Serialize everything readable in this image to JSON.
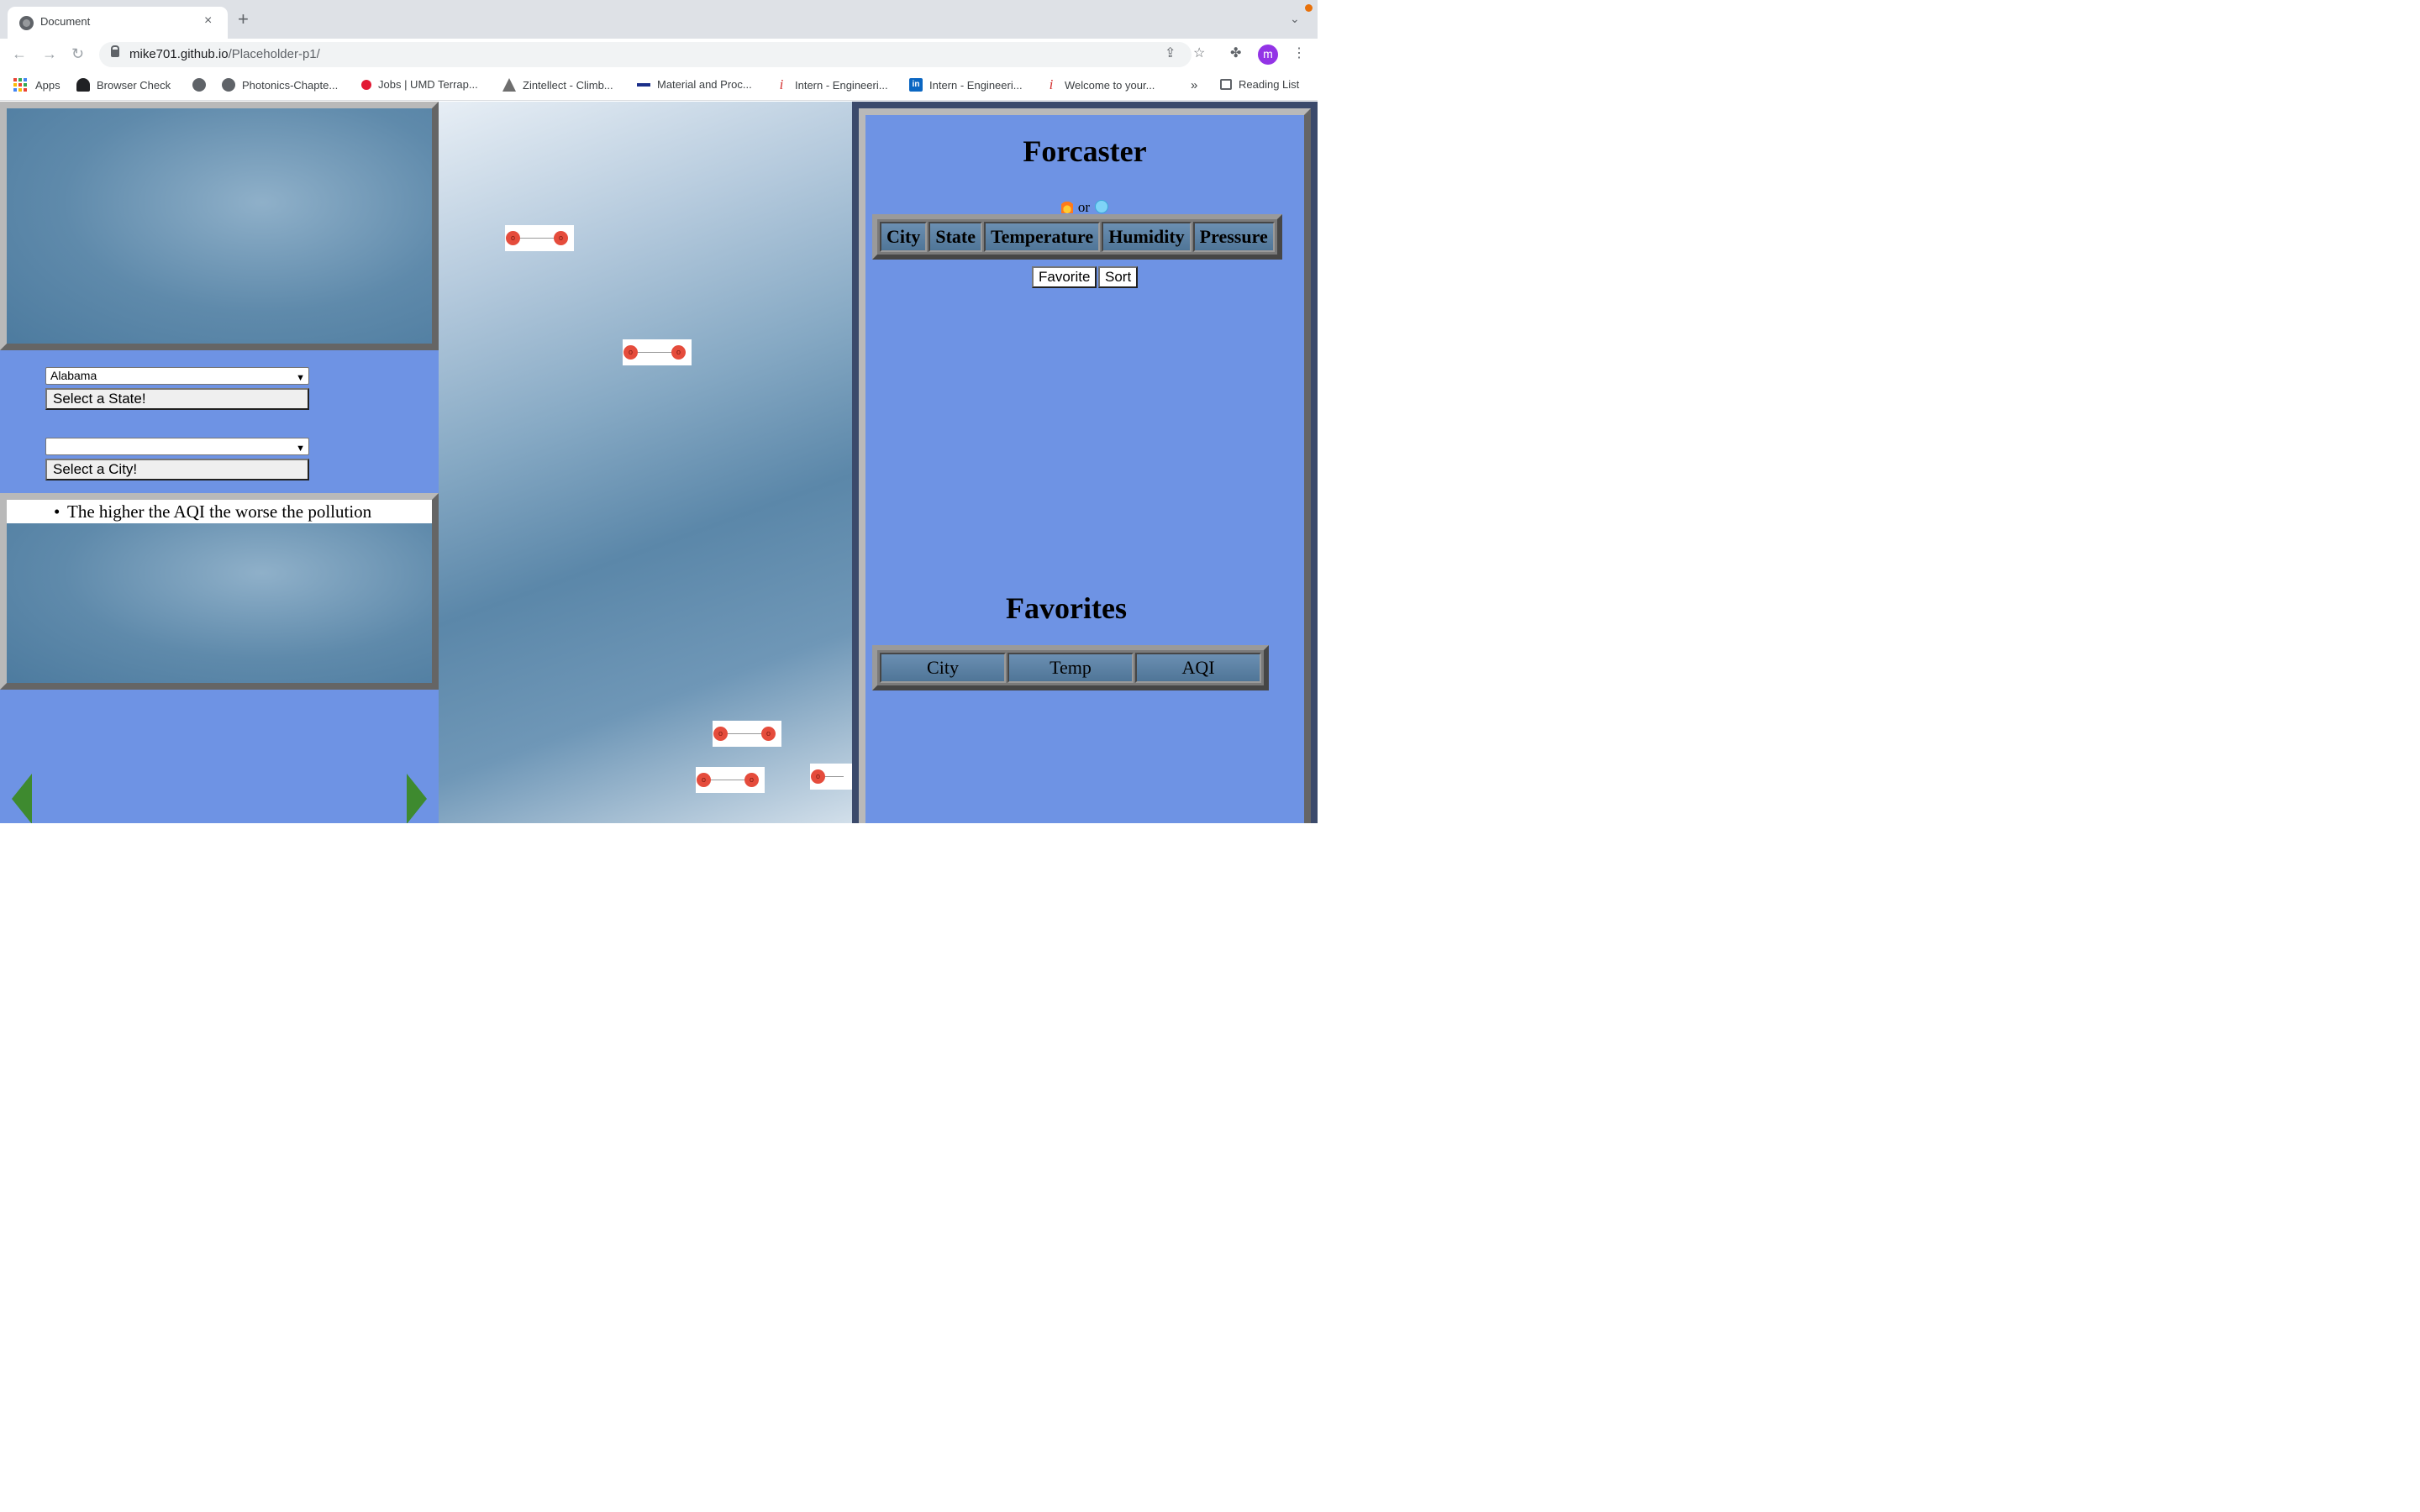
{
  "browser": {
    "tab_title": "Document",
    "close_glyph": "×",
    "new_tab_glyph": "+",
    "url_host": "mike701.github.io",
    "url_path": "/Placeholder-p1/",
    "avatar_letter": "m",
    "bookmarks": [
      {
        "label": "Apps",
        "icon": "apps-grid-icon"
      },
      {
        "label": "Browser Check",
        "icon": "person-icon"
      },
      {
        "label": "",
        "icon": "globe-icon"
      },
      {
        "label": "Photonics-Chapte...",
        "icon": "globe-icon"
      },
      {
        "label": "Jobs | UMD Terrap...",
        "icon": "umd-icon"
      },
      {
        "label": "Zintellect - Climb...",
        "icon": "zintellect-icon"
      },
      {
        "label": "Material and Proc...",
        "icon": "plane-icon"
      },
      {
        "label": "Intern - Engineeri...",
        "icon": "info-icon"
      },
      {
        "label": "Intern - Engineeri...",
        "icon": "linkedin-icon"
      },
      {
        "label": "Welcome to your...",
        "icon": "info-icon"
      }
    ],
    "bookmarks_overflow": "»",
    "reading_list": "Reading List"
  },
  "left": {
    "state_select_value": "Alabama",
    "state_button": "Select a State!",
    "city_select_value": "",
    "city_button": "Select a City!",
    "aqi_note": "The higher the AQI the worse the pollution"
  },
  "right": {
    "title": "Forcaster",
    "emoji_or": "or",
    "columns": [
      "City",
      "State",
      "Temperature",
      "Humidity",
      "Pressure"
    ],
    "favorite_button": "Favorite",
    "sort_button": "Sort",
    "favorites_title": "Favorites",
    "favorites_columns": [
      "City",
      "Temp",
      "AQI"
    ]
  },
  "dumbbell_glyph": "o",
  "colors": {
    "page_bg": "#6e93e4",
    "arrow": "#3e8a2f",
    "dot": "#e54c3c"
  }
}
